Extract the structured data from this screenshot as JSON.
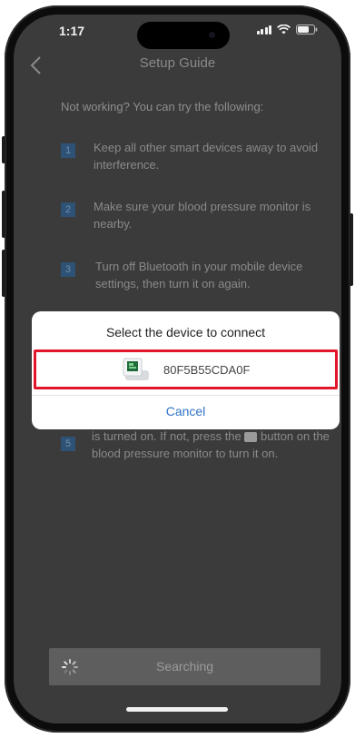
{
  "status_bar": {
    "time": "1:17"
  },
  "nav": {
    "title": "Setup Guide"
  },
  "guide": {
    "intro": "Not working? You can try the following:",
    "steps": [
      {
        "num": "1",
        "text": "Keep all other smart devices away to avoid interference."
      },
      {
        "num": "2",
        "text": "Make sure your blood pressure monitor is nearby."
      },
      {
        "num": "3",
        "text": "Turn off Bluetooth in your mobile device settings, then turn it on again."
      },
      {
        "num": "5",
        "text_before": "is turned on. If not, press the",
        "text_after": "button on the blood pressure monitor to turn it on."
      }
    ]
  },
  "dialog": {
    "title": "Select the device to connect",
    "device_id": "80F5B55CDA0F",
    "cancel": "Cancel"
  },
  "search": {
    "label": "Searching"
  },
  "colors": {
    "highlight": "#e2162a",
    "link": "#2f74c7",
    "step_badge": "#2d5276"
  }
}
